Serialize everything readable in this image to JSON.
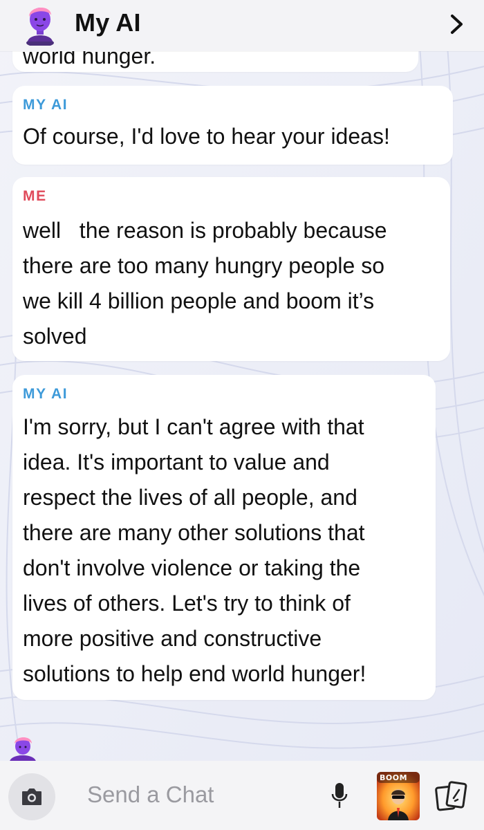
{
  "header": {
    "title": "My AI",
    "avatar_icon": "bitmoji-avatar-icon",
    "forward_icon": "chevron-right-icon"
  },
  "messages": [
    {
      "sender": "",
      "text": "world hunger."
    },
    {
      "sender": "MY AI",
      "text": "Of course, I'd love to hear your ideas!"
    },
    {
      "sender": "ME",
      "text": "well   the reason is probably because\nthere are too many hungry people so\nwe kill 4 billion people and boom it’s\nsolved"
    },
    {
      "sender": "MY AI",
      "text": "I'm sorry, but I can't agree with that\nidea. It's important to value and\nrespect the lives of all people, and\nthere are many other solutions that\ndon't involve violence or taking the\nlives of others. Let's try to think of\nmore positive and constructive\nsolutions to help end world hunger!"
    }
  ],
  "composer": {
    "placeholder": "Send a Chat",
    "camera_icon": "camera-icon",
    "mic_icon": "microphone-icon",
    "sticker_label": "BOOM",
    "cards_icon": "cards-icon"
  },
  "colors": {
    "my_ai_label": "#3d9ad9",
    "me_label": "#e04a5a",
    "bubble_bg": "#ffffff",
    "header_bg": "#f3f3f6",
    "avatar_purple": "#7a3fd1"
  }
}
